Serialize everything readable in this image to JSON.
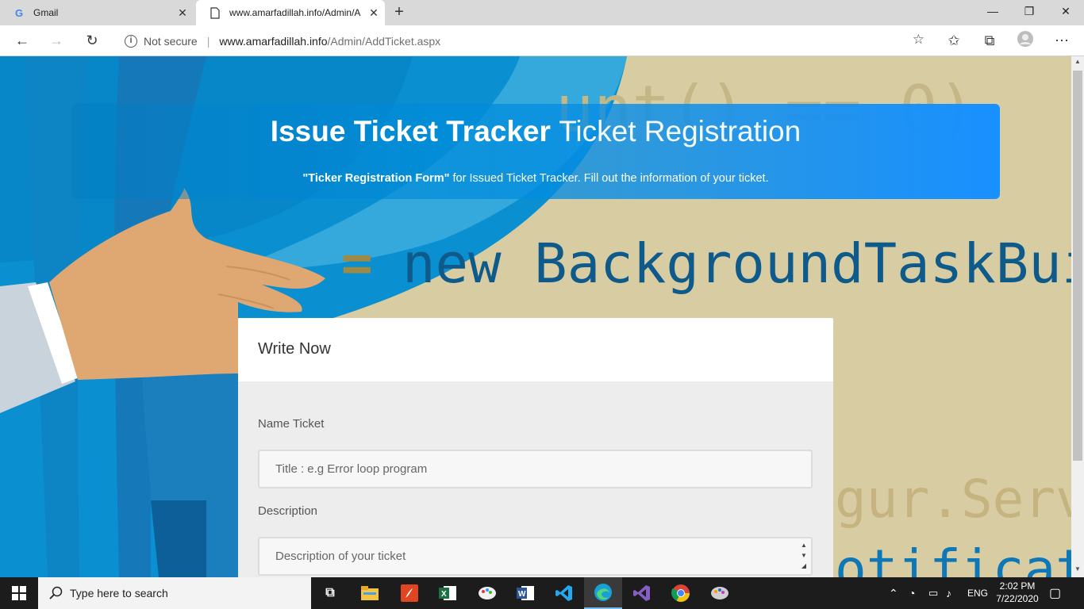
{
  "browser": {
    "tabs": [
      {
        "title": "Gmail",
        "active": false
      },
      {
        "title": "www.amarfadillah.info/Admin/A",
        "active": true
      }
    ],
    "new_tab": "+",
    "security_label": "Not secure",
    "url_domain": "www.amarfadillah.info",
    "url_path": "/Admin/AddTicket.aspx"
  },
  "background_code": {
    "line1": "unt()  ==  0)",
    "line2_prefix": "=",
    "line2": "new BackgroundTaskBuil",
    "line3": "gur.Serv",
    "line4": "otificat"
  },
  "banner": {
    "title_bold": "Issue Ticket Tracker",
    "title_light": "Ticket Registration",
    "subtitle_bold": "\"Ticker Registration Form\"",
    "subtitle_rest": " for Issued Ticket Tracker. Fill out the information of your ticket."
  },
  "form": {
    "heading": "Write Now",
    "name_label": "Name Ticket",
    "name_placeholder": "Title : e.g Error loop program",
    "desc_label": "Description",
    "desc_placeholder": "Description of your ticket"
  },
  "taskbar": {
    "search_placeholder": "Type here to search",
    "language": "ENG",
    "time": "2:02 PM",
    "date": "7/22/2020"
  },
  "colors": {
    "banner_accent": "#1890ff",
    "page_bg": "#d8cca3",
    "code_blue": "#0e5a8a"
  }
}
